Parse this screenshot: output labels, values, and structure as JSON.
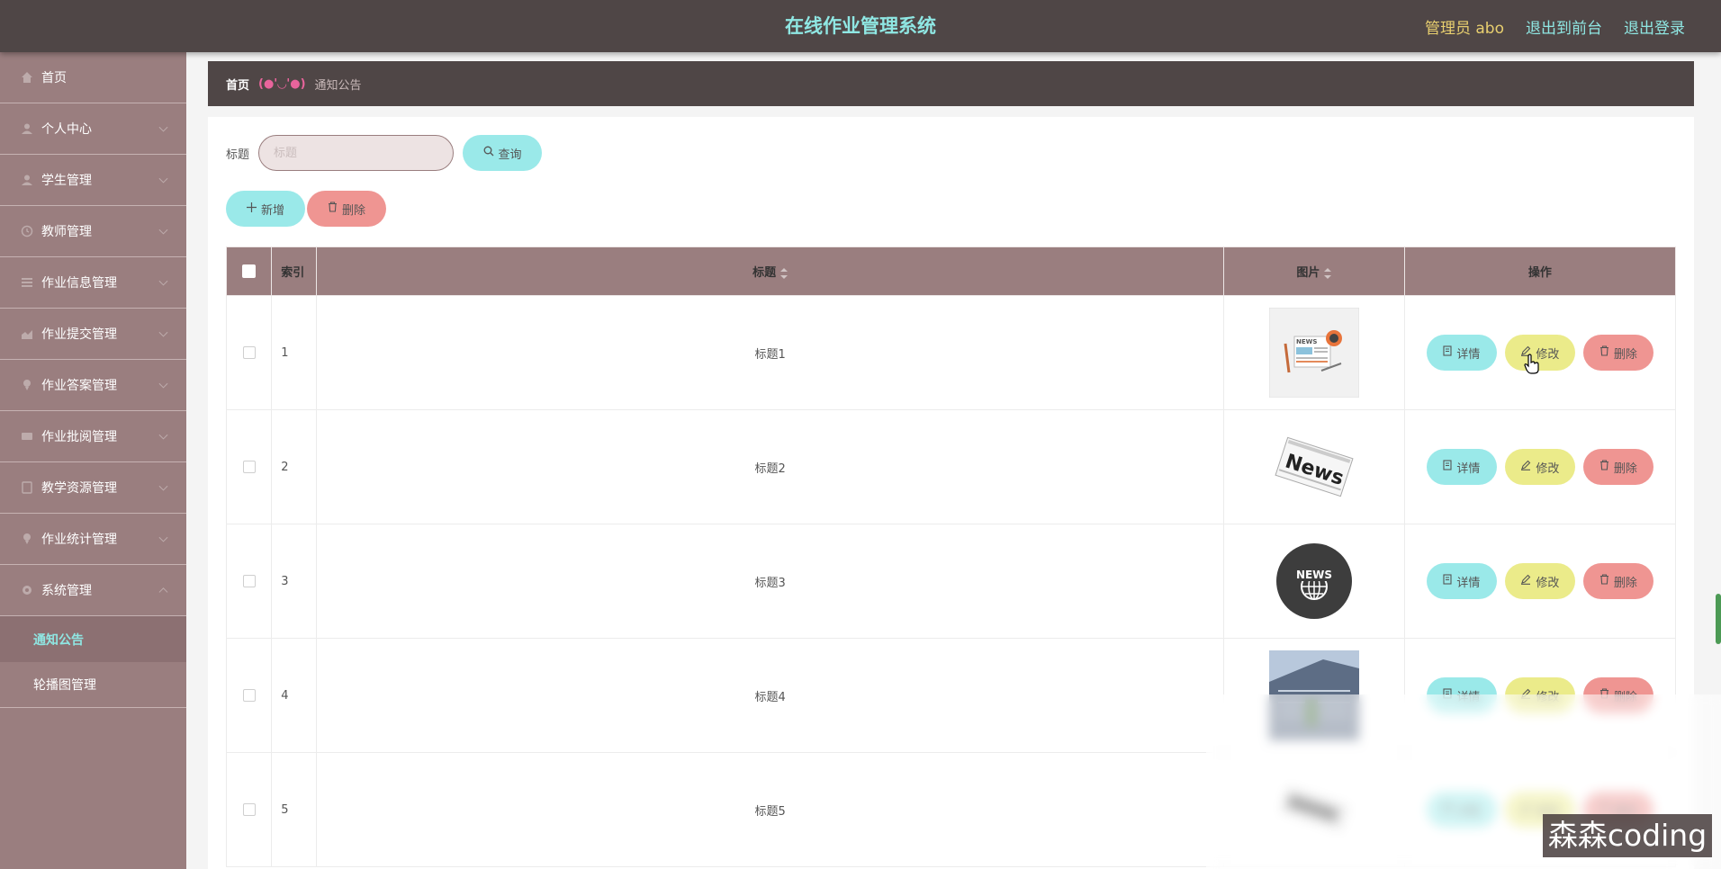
{
  "header": {
    "title": "在线作业管理系统",
    "admin_label": "管理员 abo",
    "to_front_label": "退出到前台",
    "logout_label": "退出登录"
  },
  "sidebar": {
    "items": [
      {
        "label": "首页",
        "icon": "home-icon"
      },
      {
        "label": "个人中心",
        "icon": "user-icon"
      },
      {
        "label": "学生管理",
        "icon": "user-icon"
      },
      {
        "label": "教师管理",
        "icon": "clock-icon"
      },
      {
        "label": "作业信息管理",
        "icon": "list-icon"
      },
      {
        "label": "作业提交管理",
        "icon": "chart-icon"
      },
      {
        "label": "作业答案管理",
        "icon": "pin-icon"
      },
      {
        "label": "作业批阅管理",
        "icon": "card-icon"
      },
      {
        "label": "教学资源管理",
        "icon": "doc-icon"
      },
      {
        "label": "作业统计管理",
        "icon": "pin-icon"
      },
      {
        "label": "系统管理",
        "icon": "gear-icon"
      }
    ],
    "sub_items": [
      {
        "label": "通知公告",
        "active": true
      },
      {
        "label": "轮播图管理",
        "active": false
      }
    ]
  },
  "breadcrumb": {
    "home": "首页",
    "face": "(●'◡'●)",
    "current": "通知公告"
  },
  "search": {
    "label": "标题",
    "placeholder": "标题",
    "value": "",
    "query_label": "查询"
  },
  "actions": {
    "add_label": "新增",
    "delete_label": "删除"
  },
  "table": {
    "columns": [
      "索引",
      "标题",
      "图片",
      "操作"
    ],
    "rows": [
      {
        "index": "1",
        "title": "标题1",
        "image": "news-desk"
      },
      {
        "index": "2",
        "title": "标题2",
        "image": "newspaper"
      },
      {
        "index": "3",
        "title": "标题3",
        "image": "news-globe"
      },
      {
        "index": "4",
        "title": "标题4",
        "image": "building-photo"
      },
      {
        "index": "5",
        "title": "标题5",
        "image": "newspaper-blurred"
      }
    ],
    "row_buttons": {
      "detail": "详情",
      "edit": "修改",
      "delete": "删除"
    }
  },
  "watermark": "森森coding",
  "colors": {
    "topbar": "#4f4646",
    "sidebar": "#9a7e7f",
    "accent_cyan": "#9ae9e9",
    "accent_yellow": "#ebeb8a",
    "accent_red": "#ef9592"
  }
}
